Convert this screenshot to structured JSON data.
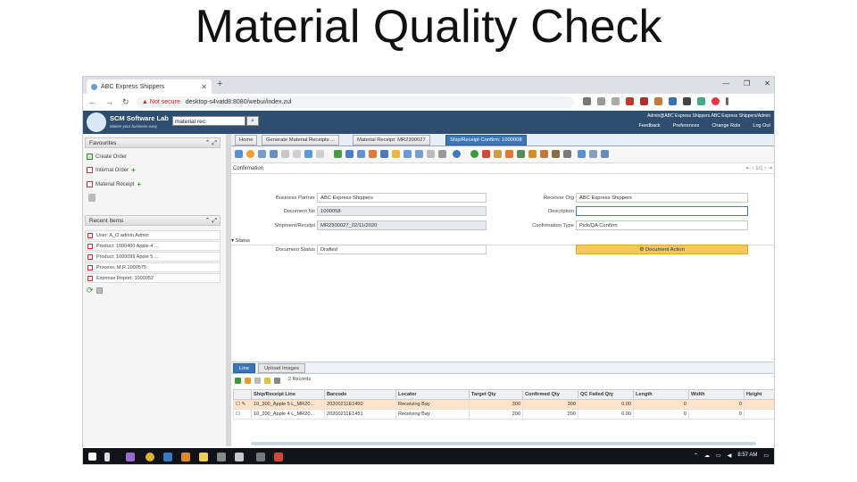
{
  "slide_title": "Material Quality Check",
  "browser": {
    "tab_title": "ABC Express Shippers",
    "not_secure": "Not secure",
    "url": "desktop-s4vatd8:8080/webui/index.zul"
  },
  "app": {
    "brand_title": "SCM Software Lab",
    "brand_subtitle": "Makes your business easy",
    "search_value": "material rec",
    "user_line": "Admin@ABC Express Shippers.ABC Express Shippers/Admin",
    "header_links": [
      "Feedback",
      "Preferences",
      "Change Role",
      "Log Out"
    ]
  },
  "left_panel": {
    "favourites_title": "Favourites",
    "favourites": [
      "Create Order",
      "Internal Order",
      "Material Receipt"
    ],
    "recent_title": "Recent Items",
    "recent": [
      "User: A_O admin Admin",
      "Product: 1000400 Apple 4 ...",
      "Product: 1000099 Apple 5 ...",
      "Process: M.R.1000575",
      "Expense Report: 1000052"
    ]
  },
  "main": {
    "tabs": [
      "Home",
      "Generate Material Receipts ...",
      "Material Receipt: MR2300027",
      "Ship/Receipt Confirm: 1000008"
    ],
    "panel_title": "Confirmation",
    "pager": "1/1",
    "fields": {
      "business_partner_label": "Business Partner",
      "business_partner": "ABC Express Shippers",
      "document_no_label": "Document No",
      "document_no": "1000058",
      "shipment_label": "Shipment/Receipt",
      "shipment": "MR2300027_02/11/2020",
      "trx_org_label": "Receiver Org",
      "trx_org": "ABC Express Shippers",
      "description_label": "Description",
      "description": "",
      "confirmation_type_label": "Confirmation Type",
      "confirmation_type": "Pick/QA Confirm",
      "status_section": "Status",
      "document_status_label": "Document Status",
      "document_status": "Drafted",
      "document_action": "Document Action"
    }
  },
  "lower": {
    "tabs": [
      "Line",
      "Upload Images"
    ],
    "record_count": "2 Records",
    "columns": [
      "Ship/Receipt Line",
      "Barcode",
      "Locator",
      "Target Qty",
      "Confirmed Qty",
      "QC Failed Qty",
      "Length",
      "Width",
      "Height"
    ],
    "rows": [
      {
        "line": "10_300_Apple 5 L_MR20...",
        "barcode": "20200211E1450",
        "locator": "Receiving Bay",
        "target": "300",
        "confirmed": "300",
        "qc_failed": "0.00",
        "length": "0",
        "width": "0",
        "height": ""
      },
      {
        "line": "10_200_Apple 4 L_MR20...",
        "barcode": "20200211E1451",
        "locator": "Receiving Bay",
        "target": "200",
        "confirmed": "200",
        "qc_failed": "0.00",
        "length": "0",
        "width": "0",
        "height": ""
      }
    ]
  },
  "taskbar": {
    "time": "8:57 AM"
  }
}
